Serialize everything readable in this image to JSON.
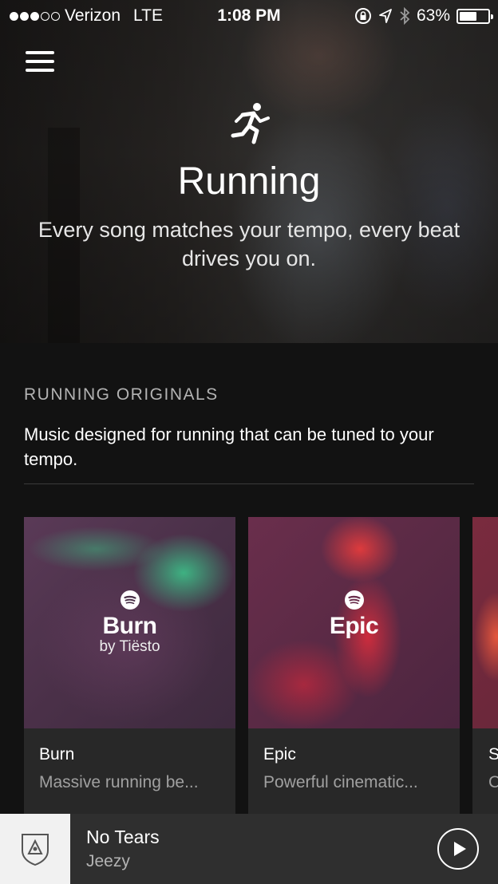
{
  "status_bar": {
    "carrier": "Verizon",
    "network": "LTE",
    "time": "1:08 PM",
    "battery": "63%",
    "battery_level": 0.63,
    "signal_bars": 3,
    "signal_total": 5
  },
  "hero": {
    "icon": "runner-icon",
    "title": "Running",
    "subtitle": "Every song matches your tempo, every beat drives you on."
  },
  "section": {
    "kicker": "RUNNING ORIGINALS",
    "description": "Music designed for running that can be tuned to your tempo."
  },
  "cards": [
    {
      "art_name": "Burn",
      "art_by": "by Tiësto",
      "title": "Burn",
      "subtitle": "Massive running be..."
    },
    {
      "art_name": "Epic",
      "art_by": "",
      "title": "Epic",
      "subtitle": "Powerful cinematic..."
    },
    {
      "art_name": "",
      "art_by": "",
      "title": "S",
      "subtitle": "C"
    }
  ],
  "now_playing": {
    "title": "No Tears",
    "artist": "Jeezy"
  },
  "colors": {
    "background": "#121212",
    "card": "#282828",
    "player_bar": "#2f2f2f",
    "muted_text": "#b3b3b3"
  }
}
